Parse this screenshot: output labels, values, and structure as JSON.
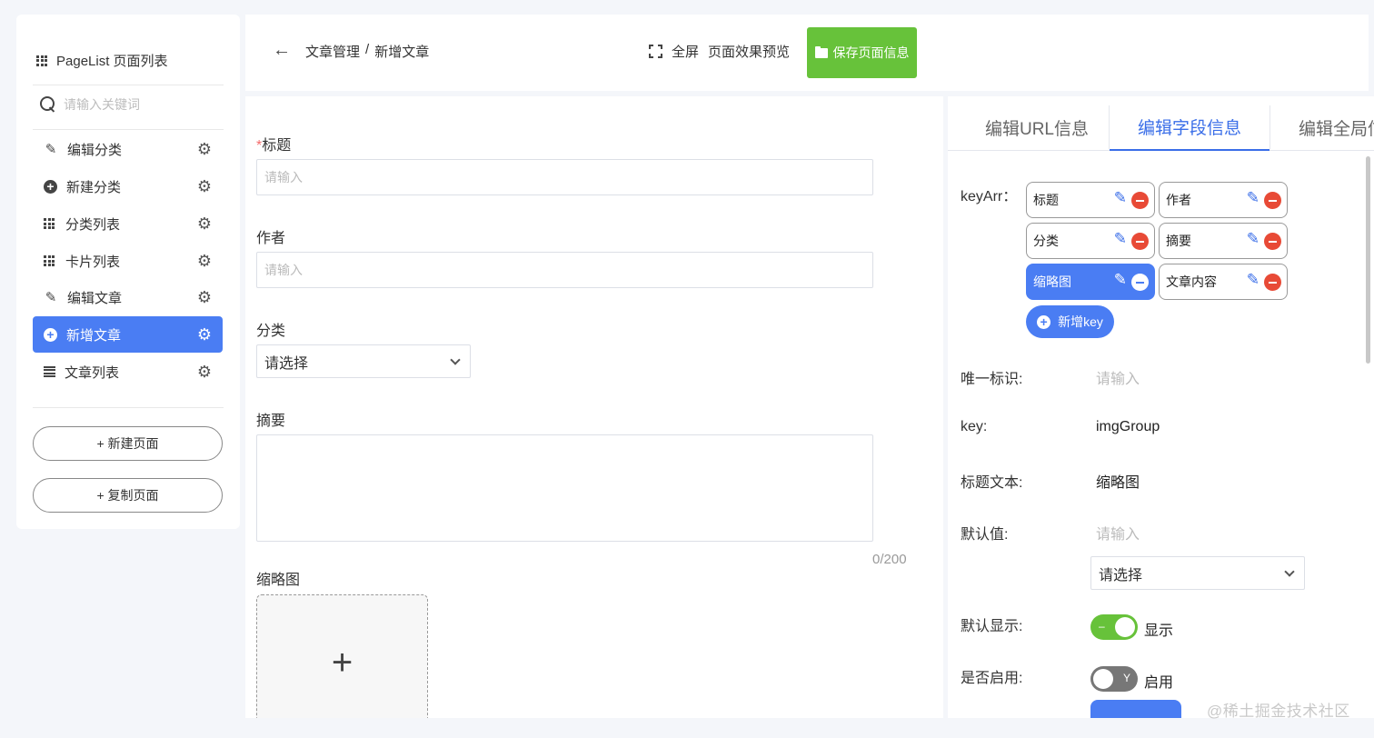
{
  "sidebar": {
    "title": "PageList 页面列表",
    "search_placeholder": "请输入关键词",
    "items": [
      {
        "label": "编辑分类",
        "icon": "pencil-icon",
        "active": false
      },
      {
        "label": "新建分类",
        "icon": "plus-circle-icon",
        "active": false
      },
      {
        "label": "分类列表",
        "icon": "grid-icon",
        "active": false
      },
      {
        "label": "卡片列表",
        "icon": "grid-icon",
        "active": false
      },
      {
        "label": "编辑文章",
        "icon": "pencil-icon",
        "active": false
      },
      {
        "label": "新增文章",
        "icon": "plus-circle-icon",
        "active": true
      },
      {
        "label": "文章列表",
        "icon": "list-icon",
        "active": false
      }
    ],
    "new_page_label": "+ 新建页面",
    "copy_page_label": "+ 复制页面"
  },
  "header": {
    "breadcrumb_parent": "文章管理",
    "breadcrumb_sep": "/",
    "breadcrumb_current": "新增文章",
    "fullscreen_label": "全屏",
    "preview_label": "页面效果预览",
    "save_label": "保存页面信息"
  },
  "form": {
    "title_required_mark": "*",
    "title_label": "标题",
    "title_placeholder": "请输入",
    "author_label": "作者",
    "author_placeholder": "请输入",
    "category_label": "分类",
    "category_value": "请选择",
    "summary_label": "摘要",
    "summary_counter": "0/200",
    "thumbnail_label": "缩略图",
    "upload_plus": "+"
  },
  "right_panel": {
    "tabs": [
      {
        "label": "编辑URL信息",
        "active": false
      },
      {
        "label": "编辑字段信息",
        "active": true
      },
      {
        "label": "编辑全局信息",
        "active": false
      }
    ],
    "keyarr_label": "keyArr：",
    "keys": [
      {
        "label": "标题",
        "selected": false
      },
      {
        "label": "作者",
        "selected": false
      },
      {
        "label": "分类",
        "selected": false
      },
      {
        "label": "摘要",
        "selected": false
      },
      {
        "label": "缩略图",
        "selected": true
      },
      {
        "label": "文章内容",
        "selected": false
      }
    ],
    "add_key_label": "新增key",
    "unique_id_label": "唯一标识:",
    "unique_id_placeholder": "请输入",
    "key_label": "key:",
    "key_value": "imgGroup",
    "title_text_label": "标题文本:",
    "title_text_value": "缩略图",
    "default_value_label": "默认值:",
    "default_value_placeholder": "请输入",
    "default_select_value": "请选择",
    "default_show_label": "默认显示:",
    "default_show_toggle_text": "–",
    "default_show_state": "显示",
    "enabled_label": "是否启用:",
    "enabled_toggle_text": "Y",
    "enabled_state": "启用"
  },
  "watermark": "@稀土掘金技术社区",
  "colors": {
    "accent": "#4a7df3",
    "save_green": "#67c23a",
    "danger": "#e84a36"
  }
}
